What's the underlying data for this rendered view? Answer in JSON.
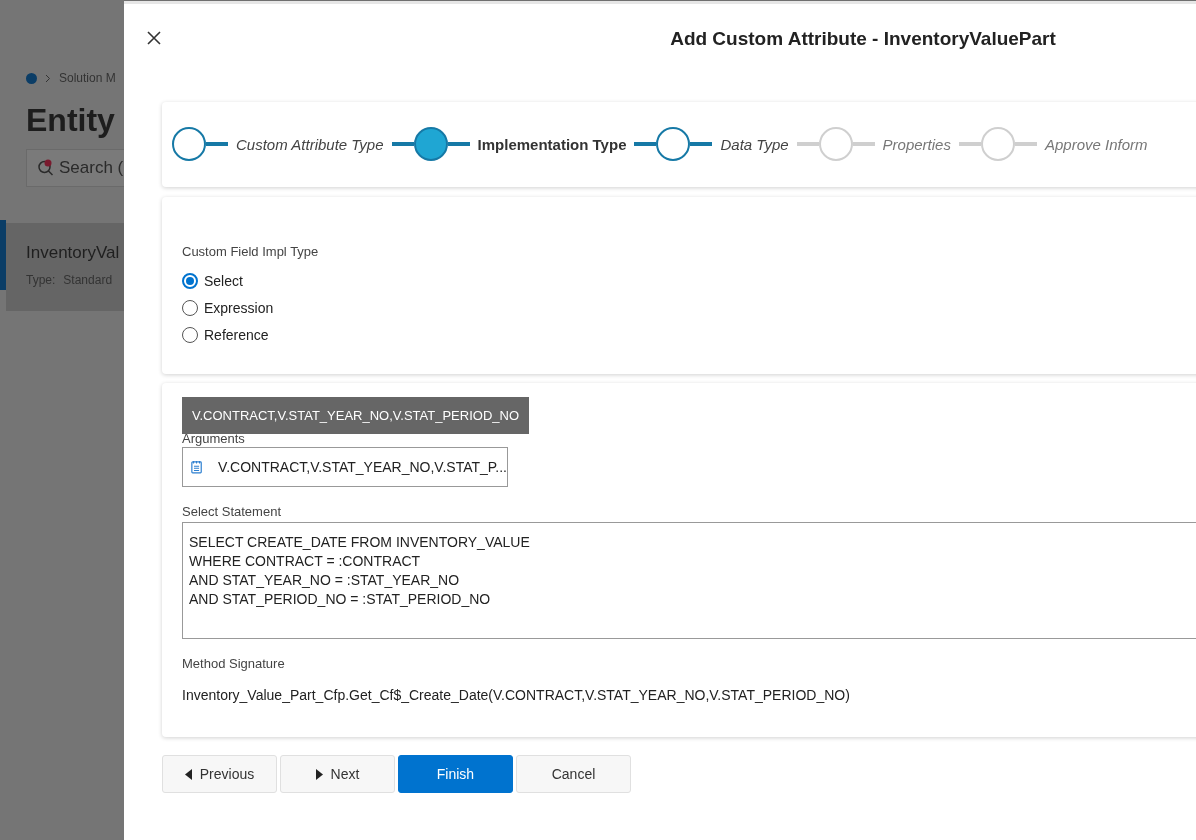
{
  "background_page": {
    "breadcrumb": "Solution M",
    "title": "Entity",
    "search": "Search (",
    "list_item": {
      "name": "InventoryVal",
      "type_label": "Type:",
      "type_value": "Standard"
    }
  },
  "dialog": {
    "title": "Add Custom Attribute - InventoryValuePart",
    "steps": [
      {
        "label": "Custom Attribute Type",
        "completed": true,
        "selected": false
      },
      {
        "label": "Implementation Type",
        "completed": true,
        "selected": true
      },
      {
        "label": "Data Type",
        "completed": true,
        "selected": false
      },
      {
        "label": "Properties",
        "completed": false,
        "selected": false
      },
      {
        "label": "Approve Inform",
        "completed": false,
        "selected": false
      }
    ],
    "impl_type": {
      "label": "Custom Field Impl Type",
      "options": [
        {
          "label": "Select",
          "selected": true
        },
        {
          "label": "Expression",
          "selected": false
        },
        {
          "label": "Reference",
          "selected": false
        }
      ]
    },
    "arguments": {
      "label": "Arguments",
      "value": "V.CONTRACT,V.STAT_YEAR_NO,V.STAT_P...",
      "tooltip": "V.CONTRACT,V.STAT_YEAR_NO,V.STAT_PERIOD_NO"
    },
    "select_statement": {
      "label": "Select Statement",
      "lines": [
        "SELECT CREATE_DATE FROM INVENTORY_VALUE",
        "WHERE CONTRACT = :CONTRACT",
        "AND STAT_YEAR_NO = :STAT_YEAR_NO",
        "AND STAT_PERIOD_NO = :STAT_PERIOD_NO"
      ]
    },
    "method_signature": {
      "label": "Method Signature",
      "value": "Inventory_Value_Part_Cfp.Get_Cf$_Create_Date(V.CONTRACT,V.STAT_YEAR_NO,V.STAT_PERIOD_NO)"
    },
    "buttons": [
      {
        "label": "Previous",
        "kind": "previous"
      },
      {
        "label": "Next",
        "kind": "next"
      },
      {
        "label": "Finish",
        "kind": "primary"
      },
      {
        "label": "Cancel",
        "kind": "plain"
      }
    ]
  }
}
